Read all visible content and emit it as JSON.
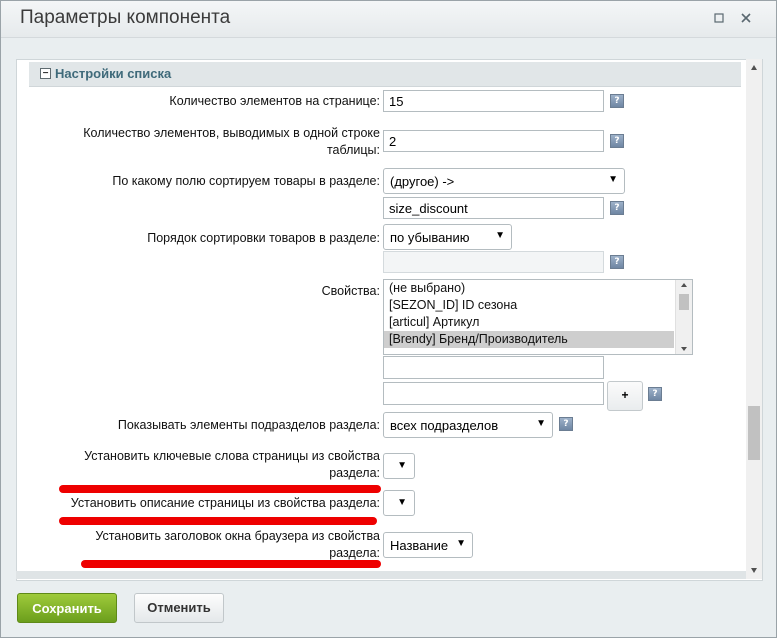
{
  "dialog": {
    "title": "Параметры компонента",
    "maximize_icon": "maximize-icon",
    "close_icon": "close-icon"
  },
  "section": {
    "title": "Настройки списка",
    "toggle_symbol": "−"
  },
  "fields": {
    "per_page": {
      "label": "Количество элементов на странице:",
      "value": "15"
    },
    "per_row": {
      "label_line1": "Количество элементов, выводимых в одной строке",
      "label_line2": "таблицы:",
      "value": "2"
    },
    "sort_field": {
      "label": "По какому полю сортируем товары в разделе:",
      "value": "(другое) ->",
      "custom_value": "size_discount"
    },
    "sort_order": {
      "label": "Порядок сортировки товаров в разделе:",
      "value": "по убыванию",
      "extra_value": ""
    },
    "properties": {
      "label": "Свойства:",
      "options": [
        "(не выбрано)",
        "[SEZON_ID] ID сезона",
        "[articul] Артикул",
        "[Brendy] Бренд/Производитель"
      ],
      "selected": "[Brendy] Бренд/Производитель",
      "extra1": "",
      "extra2": "",
      "add_label": "+"
    },
    "show_subsections": {
      "label": "Показывать элементы подразделов раздела:",
      "value": "всех подразделов"
    },
    "set_keywords": {
      "label_line1": "Установить ключевые слова страницы из свойства",
      "label_line2": "раздела:",
      "value": ""
    },
    "set_description": {
      "label": "Установить описание страницы из свойства раздела:",
      "value": ""
    },
    "set_browser_title": {
      "label_line1": "Установить заголовок окна браузера из свойства",
      "label_line2": "раздела:",
      "value": "Название"
    }
  },
  "help_glyph": "?",
  "arrow_glyph": "▼",
  "footer": {
    "save_label": "Сохранить",
    "cancel_label": "Отменить"
  },
  "colors": {
    "save_button": "#7fb02a",
    "annotation": "#ee0000",
    "section_title": "#3f6a7a"
  }
}
